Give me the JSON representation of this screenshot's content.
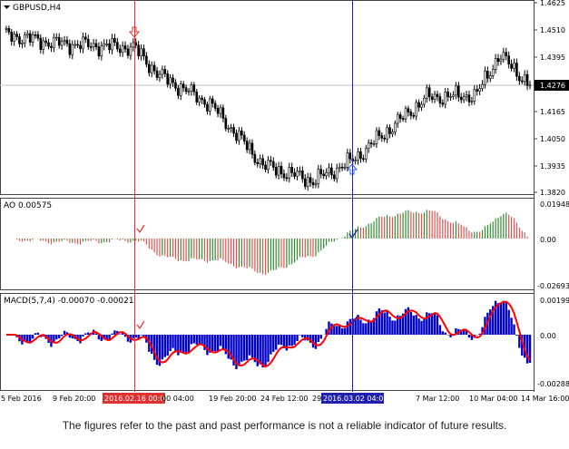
{
  "main": {
    "symbol": "GBPUSD,H4",
    "current_price": "1.4276",
    "price_ticks": [
      "1.4625",
      "1.4510",
      "1.4395",
      "1.4276",
      "1.4165",
      "1.4050",
      "1.3935",
      "1.3820"
    ],
    "cursor_left": "2016.02.16 00:00",
    "cursor_right": "2016.03.02 04:00"
  },
  "ao": {
    "label": "AO 0.00575",
    "ticks": [
      "0.01948",
      "0.00",
      "-0.02693"
    ]
  },
  "macd": {
    "label": "MACD(5,7,4) -0.00070 -0.00021",
    "ticks": [
      "0.00199",
      "0.00",
      "-0.00288"
    ]
  },
  "time_labels": [
    "5 Feb 2016",
    "9 Feb 20:00",
    "00 04:00",
    "19 Feb 20:00",
    "24 Feb 12:00",
    "29",
    "7 Mar 12:00",
    "10 Mar 04:00",
    "14 Mar 16:00"
  ],
  "disclaimer": "The figures refer to the past and past performance is not a reliable indicator of future results.",
  "colors": {
    "bull_bar": "#2e8b2e",
    "bear_bar": "#e05050",
    "macd_hist": "#0000cc",
    "signal_line": "#ff0000",
    "cursor_red": "#e03030",
    "cursor_blue": "#2020b0"
  },
  "chart_data": {
    "type": "candlestick",
    "symbol": "GBPUSD",
    "timeframe": "H4",
    "price_range": [
      1.38,
      1.464
    ],
    "key_points": [
      {
        "x": "5 Feb 2016",
        "price": 1.45
      },
      {
        "x": "9 Feb 20:00",
        "price": 1.446
      },
      {
        "x": "2016.02.16 00:00",
        "price": 1.444
      },
      {
        "x": "17 Feb",
        "price": 1.432
      },
      {
        "x": "19 Feb 20:00",
        "price": 1.419
      },
      {
        "x": "24 Feb 12:00",
        "price": 1.392
      },
      {
        "x": "29 Feb",
        "price": 1.385
      },
      {
        "x": "2016.03.02 04:00",
        "price": 1.394
      },
      {
        "x": "7 Mar 12:00",
        "price": 1.422
      },
      {
        "x": "10 Mar 04:00",
        "price": 1.423
      },
      {
        "x": "11 Mar",
        "price": 1.441
      },
      {
        "x": "14 Mar 16:00",
        "price": 1.4276
      }
    ],
    "indicators": [
      {
        "name": "AO",
        "value": 0.00575,
        "range": [
          -0.02693,
          0.01948
        ]
      },
      {
        "name": "MACD(5,7,4)",
        "macd": -0.0007,
        "signal": -0.00021,
        "range": [
          -0.00288,
          0.00199
        ]
      }
    ]
  }
}
